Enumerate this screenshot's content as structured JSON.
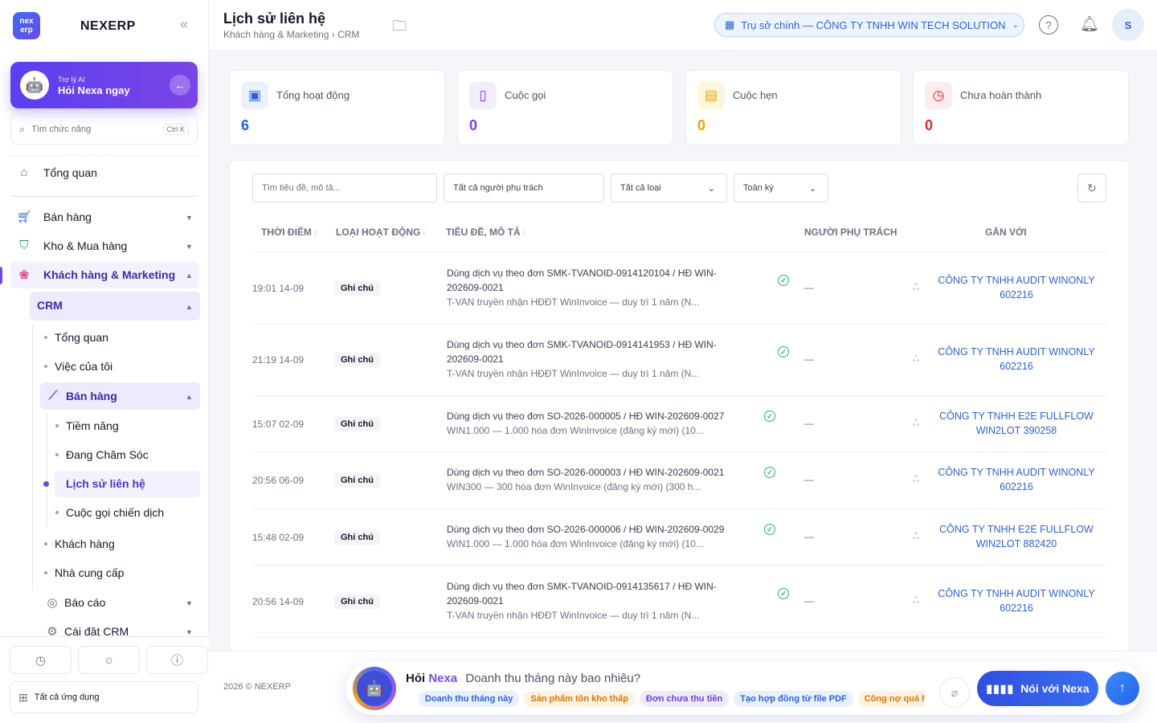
{
  "brand": {
    "logo": "nex erp",
    "name": "NEXERP",
    "collapse_icon": "«"
  },
  "ai_card": {
    "small": "Trợ lý AI",
    "title": "Hỏi Nexa ngay"
  },
  "sidebar_search": {
    "placeholder": "Tìm chức năng",
    "shortcut": "Ctrl K"
  },
  "nav": {
    "overview": "Tổng quan",
    "sales": "Bán hàng",
    "warehouse": "Kho & Mua hàng",
    "crm_marketing": "Khách hàng & Marketing",
    "crm": "CRM",
    "crm_overview": "Tổng quan",
    "my_tasks": "Việc của tôi",
    "crm_sales": "Bán hàng",
    "prospects": "Tiềm năng",
    "caring": "Đang Chăm Sóc",
    "contact_history": "Lịch sử liên hệ",
    "campaign_calls": "Cuộc gọi chiến dịch",
    "customers": "Khách hàng",
    "suppliers": "Nhà cung cấp",
    "reports": "Báo cáo",
    "crm_settings": "Cài đặt CRM",
    "all_apps": "Tất cả ứng dụng"
  },
  "header": {
    "title": "Lịch sử liên hệ",
    "breadcrumb": "Khách hàng & Marketing › CRM",
    "branch": "Trụ sở chính — CÔNG TY TNHH WIN TECH SOLUTION",
    "avatar": "S"
  },
  "stats": [
    {
      "label": "Tổng hoạt động",
      "value": "6",
      "color": "#2b62d8",
      "bg": "#eaf1fd"
    },
    {
      "label": "Cuộc gọi",
      "value": "0",
      "color": "#7c3aed",
      "bg": "#f3ecfd"
    },
    {
      "label": "Cuộc hẹn",
      "value": "0",
      "color": "#e8a400",
      "bg": "#fdf5dc"
    },
    {
      "label": "Chưa hoàn thành",
      "value": "0",
      "color": "#dc2626",
      "bg": "#fdecec"
    }
  ],
  "filters": {
    "search_placeholder": "Tìm tiêu đề, mô tả...",
    "owner_placeholder": "Tất cả người phụ trách",
    "type": "Tất cả loại",
    "period": "Toàn kỳ"
  },
  "columns": {
    "time": "THỜI ĐIỂM",
    "type": "LOẠI HOẠT ĐỘNG",
    "desc": "TIÊU ĐỀ, MÔ TẢ",
    "owner": "NGƯỜI PHỤ TRÁCH",
    "linked": "GẮN VỚI"
  },
  "rows": [
    {
      "time": "19:01 14-09",
      "type": "Ghi chú",
      "title": "Dùng dịch vụ theo đơn SMK-TVANOID-0914120104 / HĐ WIN-202609-0021",
      "sub": "T-VAN truyền nhận HĐĐT WinInvoice — duy trì 1 năm (N...",
      "owner": "—",
      "linked": "CÔNG TY TNHH AUDIT WINONLY 602216"
    },
    {
      "time": "21:19 14-09",
      "type": "Ghi chú",
      "title": "Dùng dịch vụ theo đơn SMK-TVANOID-0914141953 / HĐ WIN-202609-0021",
      "sub": "T-VAN truyền nhận HĐĐT WinInvoice — duy trì 1 năm (N...",
      "owner": "—",
      "linked": "CÔNG TY TNHH AUDIT WINONLY 602216"
    },
    {
      "time": "15:07 02-09",
      "type": "Ghi chú",
      "title": "Dùng dịch vụ theo đơn SO-2026-000005 / HĐ WIN-202609-0027",
      "sub": "WIN1.000 — 1.000 hóa đơn WinInvoice (đăng ký mới) (10...",
      "owner": "—",
      "linked": "CÔNG TY TNHH E2E FULLFLOW WIN2LOT 390258"
    },
    {
      "time": "20:56 06-09",
      "type": "Ghi chú",
      "title": "Dùng dịch vụ theo đơn SO-2026-000003 / HĐ WIN-202609-0021",
      "sub": "WIN300 — 300 hóa đơn WinInvoice (đăng ký mới) (300 h...",
      "owner": "—",
      "linked": "CÔNG TY TNHH AUDIT WINONLY 602216"
    },
    {
      "time": "15:48 02-09",
      "type": "Ghi chú",
      "title": "Dùng dịch vụ theo đơn SO-2026-000006 / HĐ WIN-202609-0029",
      "sub": "WIN1.000 — 1.000 hóa đơn WinInvoice (đăng ký mới) (10...",
      "owner": "—",
      "linked": "CÔNG TY TNHH E2E FULLFLOW WIN2LOT 882420"
    },
    {
      "time": "20:56 14-09",
      "type": "Ghi chú",
      "title": "Dùng dịch vụ theo đơn SMK-TVANOID-0914135617 / HĐ WIN-202609-0021",
      "sub": "T-VAN truyền nhận HĐĐT WinInvoice — duy trì 1 năm (N...",
      "owner": "—",
      "linked": "CÔNG TY TNHH AUDIT WINONLY 602216"
    }
  ],
  "footer": {
    "copyright": "2026 © NEXERP",
    "ask": "Hỏi",
    "nexa": "Nexa",
    "question": "Doanh thu tháng này bao nhiêu?",
    "chips": [
      {
        "label": "Doanh thu tháng này",
        "color": "#2b62d8",
        "bg": "#e8f0fd"
      },
      {
        "label": "Sản phẩm tồn kho thấp",
        "color": "#d97706",
        "bg": "#fdf1e2"
      },
      {
        "label": "Đơn chưa thu tiền",
        "color": "#6d3fd8",
        "bg": "#efe9fc"
      },
      {
        "label": "Tạo hợp đồng từ file PDF",
        "color": "#2b62d8",
        "bg": "#e8f0fd"
      },
      {
        "label": "Công nợ quá hạn",
        "color": "#d97706",
        "bg": "#fdf1e2"
      }
    ],
    "talk": "Nói với Nexa"
  }
}
